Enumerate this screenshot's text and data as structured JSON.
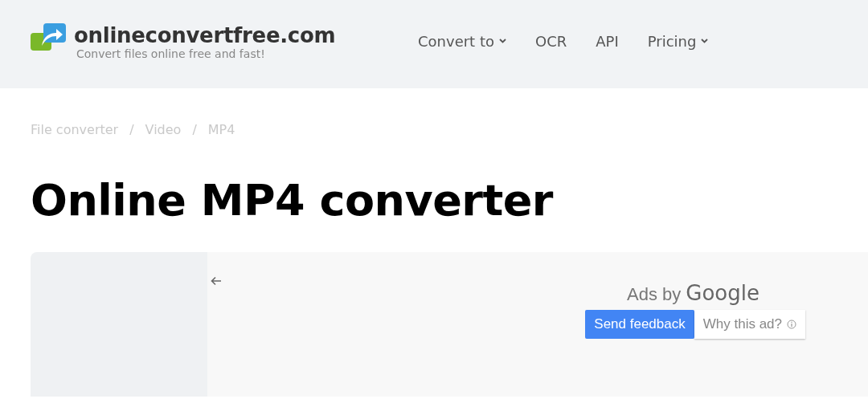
{
  "header": {
    "logo_name": "onlineconvertfree.com",
    "tagline": "Convert files online free and fast!",
    "nav": [
      {
        "label": "Convert to",
        "kind": "dropdown"
      },
      {
        "label": "OCR",
        "kind": "link"
      },
      {
        "label": "API",
        "kind": "link"
      },
      {
        "label": "Pricing",
        "kind": "dropdown"
      }
    ]
  },
  "breadcrumb": [
    {
      "label": "File converter"
    },
    {
      "label": "Video"
    },
    {
      "label": "MP4"
    }
  ],
  "breadcrumb_separator": "/",
  "title": "Online MP4 converter",
  "ad": {
    "prefix": "Ads by",
    "brand": "Google",
    "buttons": [
      {
        "label": "Send feedback",
        "kind": "primary"
      },
      {
        "label": "Why this ad?",
        "kind": "info"
      }
    ]
  }
}
